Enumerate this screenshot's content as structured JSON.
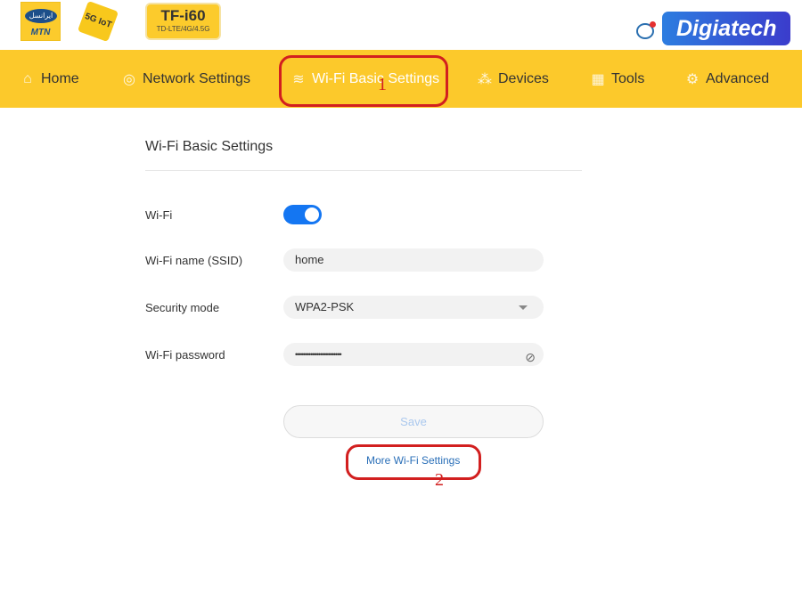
{
  "header": {
    "logos": {
      "mtn": "MTN",
      "mtn_farsi": "ایرانسل",
      "badge_5g": "5G IoT",
      "device": "TF-i60",
      "device_sub": "TD-LTE/4G/4.5G",
      "brand": "Digiatech"
    }
  },
  "nav": {
    "items": [
      {
        "label": "Home",
        "icon": "home-icon"
      },
      {
        "label": "Network Settings",
        "icon": "globe-icon"
      },
      {
        "label": "Wi-Fi Basic Settings",
        "icon": "wifi-icon",
        "active": true
      },
      {
        "label": "Devices",
        "icon": "devices-icon"
      },
      {
        "label": "Tools",
        "icon": "tools-icon"
      },
      {
        "label": "Advanced",
        "icon": "gear-icon"
      }
    ]
  },
  "annotations": {
    "one": "1",
    "two": "2",
    "color": "#d21f1f"
  },
  "main": {
    "title": "Wi-Fi Basic Settings",
    "wifi_label": "Wi-Fi",
    "wifi_enabled": true,
    "ssid_label": "Wi-Fi name (SSID)",
    "ssid_value": "home",
    "security_label": "Security mode",
    "security_value": "WPA2-PSK",
    "password_label": "Wi-Fi password",
    "password_value": "••••••••••••••••••••••••",
    "save_label": "Save",
    "more_link": "More Wi-Fi Settings"
  },
  "colors": {
    "nav": "#fcc92b",
    "accent": "#1476f2",
    "link": "#2a6fb8"
  }
}
